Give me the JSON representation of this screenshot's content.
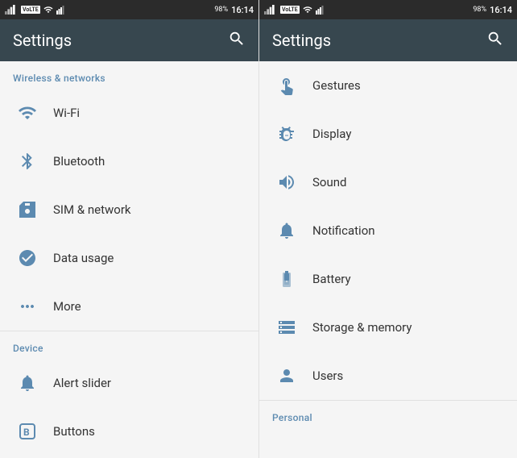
{
  "left": {
    "statusBar": {
      "volte": "VoLTE",
      "battery": "98%",
      "time": "16:14"
    },
    "appBar": {
      "title": "Settings",
      "searchLabel": "search"
    },
    "sections": [
      {
        "label": "Wireless & networks",
        "items": [
          {
            "id": "wifi",
            "text": "Wi-Fi",
            "icon": "wifi"
          },
          {
            "id": "bluetooth",
            "text": "Bluetooth",
            "icon": "bluetooth"
          },
          {
            "id": "sim",
            "text": "SIM & network",
            "icon": "sim"
          },
          {
            "id": "datausage",
            "text": "Data usage",
            "icon": "data"
          },
          {
            "id": "more",
            "text": "More",
            "icon": "more"
          }
        ]
      },
      {
        "label": "Device",
        "items": [
          {
            "id": "alertslider",
            "text": "Alert slider",
            "icon": "alert"
          },
          {
            "id": "buttons",
            "text": "Buttons",
            "icon": "buttons"
          }
        ]
      }
    ]
  },
  "right": {
    "statusBar": {
      "volte": "VoLTE",
      "battery": "98%",
      "time": "16:14"
    },
    "appBar": {
      "title": "Settings",
      "searchLabel": "search"
    },
    "sections": [
      {
        "label": "",
        "items": [
          {
            "id": "gestures",
            "text": "Gestures",
            "icon": "gestures"
          },
          {
            "id": "display",
            "text": "Display",
            "icon": "display"
          },
          {
            "id": "sound",
            "text": "Sound",
            "icon": "sound"
          },
          {
            "id": "notification",
            "text": "Notification",
            "icon": "notification"
          },
          {
            "id": "battery",
            "text": "Battery",
            "icon": "battery"
          },
          {
            "id": "storage",
            "text": "Storage & memory",
            "icon": "storage"
          },
          {
            "id": "users",
            "text": "Users",
            "icon": "users"
          }
        ]
      },
      {
        "label": "Personal",
        "items": []
      }
    ]
  }
}
